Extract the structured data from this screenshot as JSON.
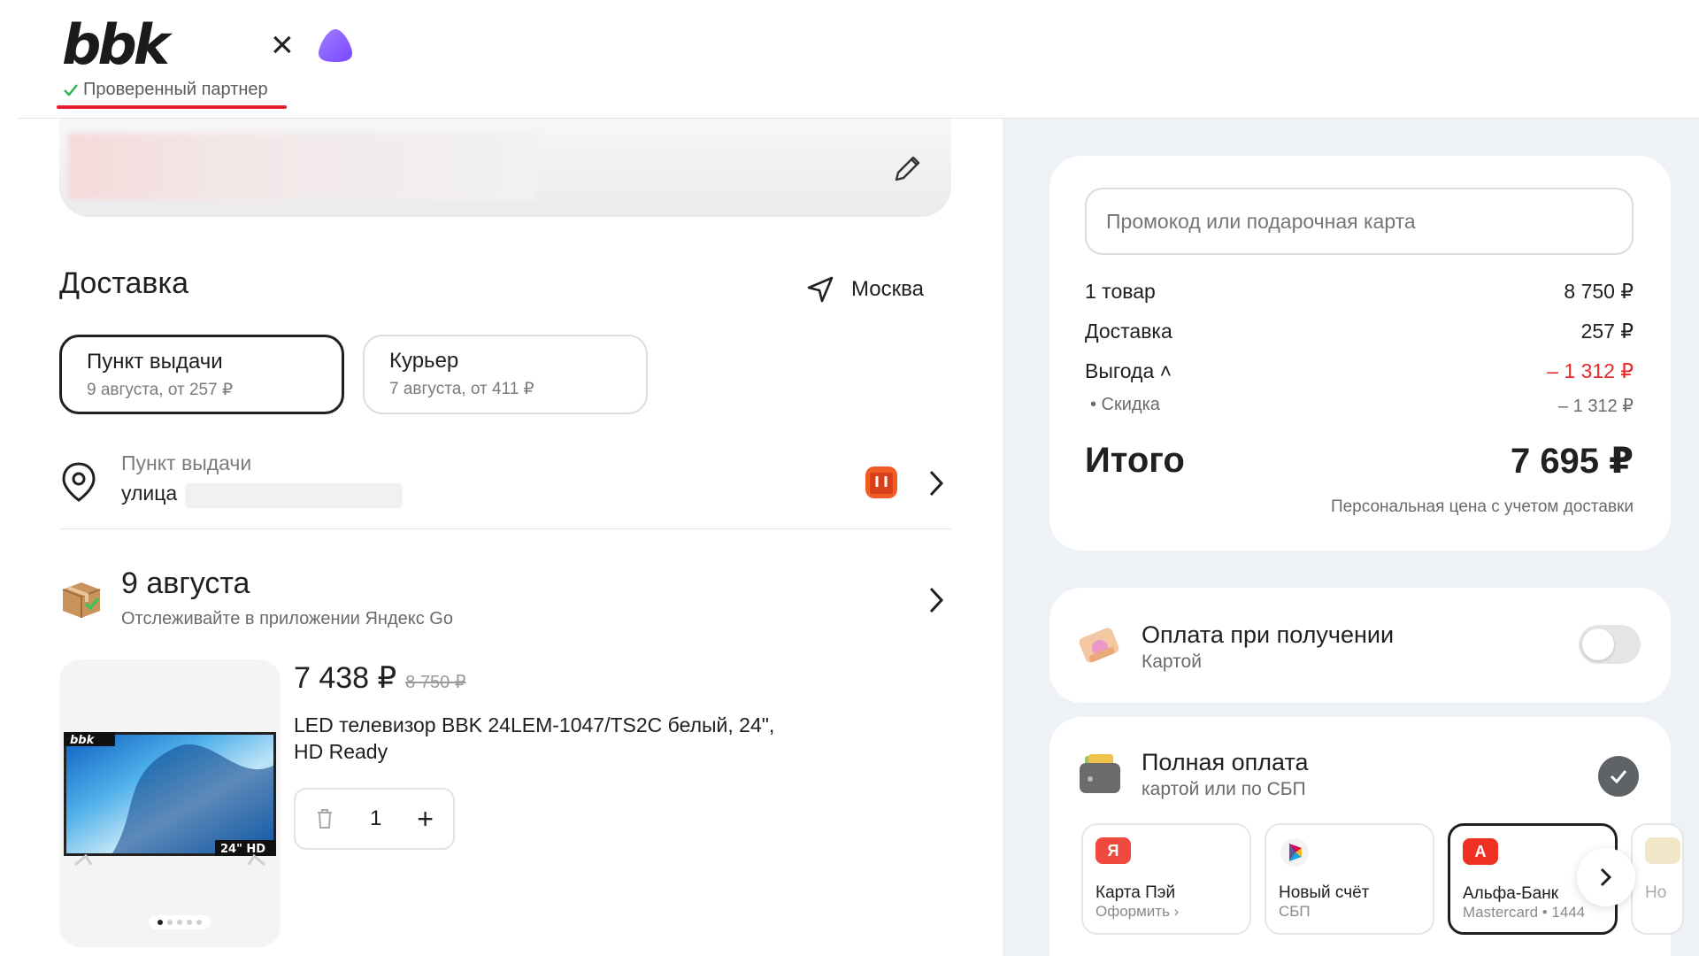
{
  "header": {
    "brand": "bbk",
    "times": "×",
    "verified": "Проверенный партнер",
    "accent_red": "#e41e2f"
  },
  "delivery": {
    "title": "Доставка",
    "city": "Москва",
    "options": [
      {
        "title": "Пункт выдачи",
        "subtitle": "9 августа, от 257 ₽",
        "selected": true
      },
      {
        "title": "Курьер",
        "subtitle": "7 августа, от 411 ₽",
        "selected": false
      }
    ],
    "pickup_label": "Пункт выдачи",
    "pickup_address": "улица"
  },
  "shipment": {
    "date": "9 августа",
    "track_note": "Отслеживайте в приложении Яндекс Go"
  },
  "product": {
    "price": "7 438 ₽",
    "old_price": "8 750 ₽",
    "name": "LED телевизор BBK 24LEM-1047/TS2C белый, 24\", HD Ready",
    "quantity": "1",
    "plus": "+",
    "image_badge": "24\" HD",
    "image_brand": "bbk"
  },
  "summary": {
    "promo_placeholder": "Промокод или подарочная карта",
    "rows": [
      {
        "label": "1 товар",
        "value": "8 750 ₽"
      },
      {
        "label": "Доставка",
        "value": "257 ₽"
      },
      {
        "label": "Выгода ˄",
        "value": "– 1 312 ₽"
      },
      {
        "label": "• Скидка",
        "value": "– 1 312 ₽"
      }
    ],
    "total_label": "Итого",
    "total_value": "7 695 ₽",
    "personal_note": "Персональная цена с учетом доставки"
  },
  "payment": {
    "on_delivery_title": "Оплата при получении",
    "on_delivery_sub": "Картой",
    "full_title": "Полная оплата",
    "full_sub": "картой или по СБП",
    "methods": [
      {
        "title": "Карта Пэй",
        "sub": "Оформить ›",
        "icon": "Я",
        "color": "#f04a3e"
      },
      {
        "title": "Новый счёт",
        "sub": "СБП",
        "icon": "sbp-icon",
        "color": "#ffffff"
      },
      {
        "title": "Альфа-Банк",
        "sub": "Mastercard • 1444",
        "icon": "А",
        "color": "#ef3124"
      },
      {
        "title": "Но",
        "sub": "",
        "icon": "card-icon",
        "color": "#f2e6c8"
      }
    ]
  }
}
